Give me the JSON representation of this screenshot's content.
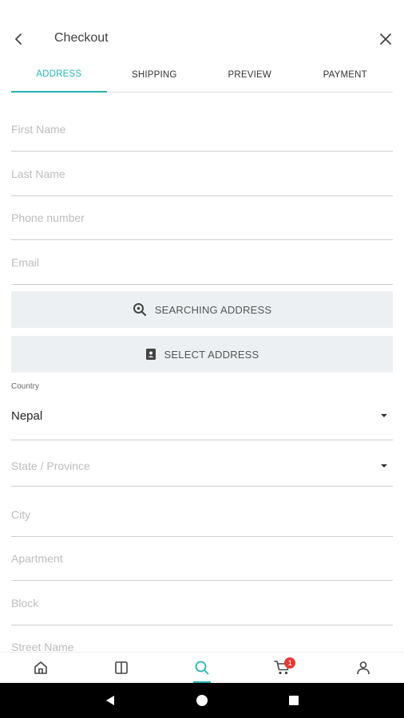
{
  "header": {
    "title": "Checkout"
  },
  "tabs": [
    {
      "label": "ADDRESS",
      "active": true
    },
    {
      "label": "SHIPPING",
      "active": false
    },
    {
      "label": "PREVIEW",
      "active": false
    },
    {
      "label": "PAYMENT",
      "active": false
    }
  ],
  "form": {
    "first_name": {
      "placeholder": "First Name",
      "value": ""
    },
    "last_name": {
      "placeholder": "Last Name",
      "value": ""
    },
    "phone": {
      "placeholder": "Phone number",
      "value": ""
    },
    "email": {
      "placeholder": "Email",
      "value": ""
    },
    "search_address_label": "SEARCHING ADDRESS",
    "select_address_label": "SELECT ADDRESS",
    "country_label": "Country",
    "country_value": "Nepal",
    "state_placeholder": "State / Province",
    "city_placeholder": "City",
    "apartment_placeholder": "Apartment",
    "block_placeholder": "Block",
    "street_placeholder": "Street Name"
  },
  "bottom_nav": {
    "items": [
      "home-icon",
      "catalog-icon",
      "search-icon",
      "cart-icon",
      "profile-icon"
    ],
    "active": "search-icon",
    "cart_badge": "1"
  },
  "colors": {
    "accent": "#27b3b3",
    "badge": "#e53935",
    "button_bg": "#edf0f2"
  }
}
